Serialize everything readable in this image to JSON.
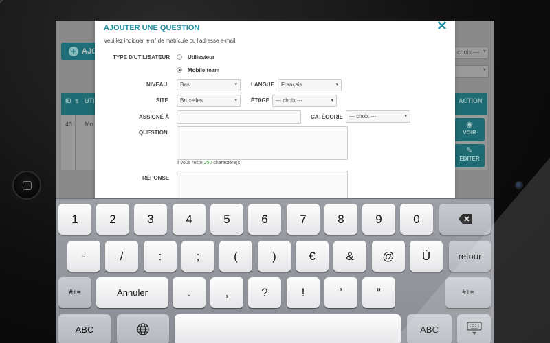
{
  "background_app": {
    "add_button_label": "AJO",
    "filter_select_1": "choix ---",
    "filter_select_2": "",
    "table_headers": {
      "id": "ID",
      "title": "UTI",
      "action": "ACTION"
    },
    "row": {
      "id": "43",
      "title": "Mo"
    },
    "view_button": "VOIR",
    "edit_button": "EDITER"
  },
  "modal": {
    "title": "AJOUTER UNE QUESTION",
    "close_icon": "close-icon",
    "subtitle": "Veuillez indiquer le n° de matricule ou l'adresse e-mail.",
    "user_type": {
      "label": "TYPE D'UTILISATEUR",
      "options": [
        {
          "label": "Utilisateur",
          "selected": false
        },
        {
          "label": "Mobile team",
          "selected": true
        }
      ]
    },
    "niveau": {
      "label": "NIVEAU",
      "value": "Bas"
    },
    "langue": {
      "label": "LANGUE",
      "value": "Français"
    },
    "site": {
      "label": "SITE",
      "value": "Bruxelles"
    },
    "etage": {
      "label": "ÉTAGE",
      "value": "--- choix ---"
    },
    "assigne": {
      "label": "ASSIGNÉ À",
      "value": ""
    },
    "categorie": {
      "label": "CATÉGORIE",
      "value": "--- choix ---"
    },
    "question": {
      "label": "QUESTION",
      "value": ""
    },
    "chars_note": {
      "prefix": "Il vous reste ",
      "count": "250",
      "suffix": " charactère(s)"
    },
    "reponse": {
      "label": "RÉPONSE",
      "value": ""
    }
  },
  "keyboard": {
    "row1": [
      "1",
      "2",
      "3",
      "4",
      "5",
      "6",
      "7",
      "8",
      "9",
      "0"
    ],
    "row2": [
      "-",
      "/",
      ":",
      ";",
      "(",
      ")",
      "€",
      "&",
      "@",
      "Ù"
    ],
    "return_label": "retour",
    "row3_left": "#+=",
    "annuler_label": "Annuler",
    "row3": [
      ".",
      ",",
      "?",
      "!",
      "’",
      "”"
    ],
    "row3_right": "#+=",
    "abc_left": "ABC",
    "abc_right": "ABC",
    "backspace_icon": "backspace-icon",
    "globe_icon": "globe-icon",
    "hide_keyboard_icon": "keyboard-hide-icon"
  },
  "colors": {
    "accent": "#1e8ea0",
    "table_header": "#1e6b74"
  }
}
